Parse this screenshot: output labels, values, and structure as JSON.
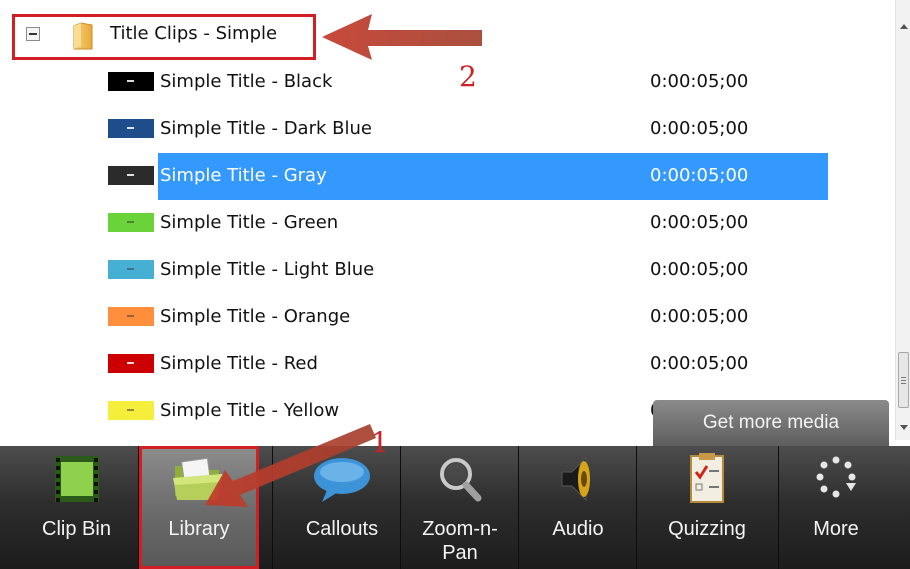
{
  "tree": {
    "folder": {
      "label": "Title Clips - Simple",
      "icon": "folder-icon",
      "expanded": true
    },
    "clips": [
      {
        "name": "Simple Title - Black",
        "duration": "0:00:05;00",
        "color": "#000000"
      },
      {
        "name": "Simple Title - Dark Blue",
        "duration": "0:00:05;00",
        "color": "#1e4d8c"
      },
      {
        "name": "Simple Title - Gray",
        "duration": "0:00:05;00",
        "color": "#2b2b2b",
        "selected": true
      },
      {
        "name": "Simple Title - Green",
        "duration": "0:00:05;00",
        "color": "#6ad33a"
      },
      {
        "name": "Simple Title - Light Blue",
        "duration": "0:00:05;00",
        "color": "#45b0d4"
      },
      {
        "name": "Simple Title - Orange",
        "duration": "0:00:05;00",
        "color": "#ff8f3d"
      },
      {
        "name": "Simple Title - Red",
        "duration": "0:00:05;00",
        "color": "#cc0000"
      },
      {
        "name": "Simple Title - Yellow",
        "duration": "0",
        "color": "#f5ee3a"
      }
    ]
  },
  "get_more_media": "Get more media",
  "toolbar": {
    "tools": [
      {
        "label": "Clip Bin",
        "icon": "film-icon"
      },
      {
        "label": "Library",
        "icon": "open-folder-icon",
        "active": true
      },
      {
        "label": "Callouts",
        "icon": "speech-bubble-icon"
      },
      {
        "label": "Zoom-n-\nPan",
        "icon": "magnifier-icon"
      },
      {
        "label": "Audio",
        "icon": "speaker-icon"
      },
      {
        "label": "Quizzing",
        "icon": "checklist-icon"
      },
      {
        "label": "More",
        "icon": "dots-icon"
      }
    ]
  },
  "annotations": {
    "step1": "1",
    "step2": "2",
    "color": "#d11f24"
  }
}
